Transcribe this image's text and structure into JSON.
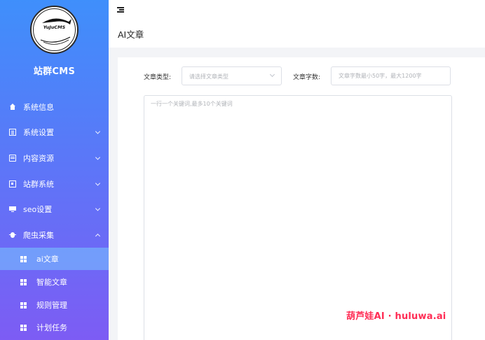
{
  "brand": {
    "logo_text": "YuJuCMS",
    "site_name": "站群CMS"
  },
  "sidebar": {
    "items": [
      {
        "label": "系统信息",
        "icon": "home-icon",
        "has_children": false
      },
      {
        "label": "系统设置",
        "icon": "list-icon",
        "has_children": true
      },
      {
        "label": "内容资源",
        "icon": "book-icon",
        "has_children": true
      },
      {
        "label": "站群系统",
        "icon": "box-icon",
        "has_children": true
      },
      {
        "label": "seo设置",
        "icon": "monitor-icon",
        "has_children": true
      },
      {
        "label": "爬虫采集",
        "icon": "bug-icon",
        "has_children": true,
        "expanded": true
      }
    ],
    "sub_items": [
      {
        "label": "ai文章",
        "active": true
      },
      {
        "label": "智能文章",
        "active": false
      },
      {
        "label": "规则管理",
        "active": false
      },
      {
        "label": "计划任务",
        "active": false
      }
    ]
  },
  "header": {
    "title": "AI文章"
  },
  "form": {
    "type_label": "文章类型:",
    "type_placeholder": "请选择文章类型",
    "count_label": "文章字数:",
    "count_placeholder": "文章字数最小50字，最大1200字",
    "keywords_placeholder": "一行一个关键词,最多10个关键词"
  },
  "watermark": "葫芦娃AI · huluwa.ai",
  "colors": {
    "sidebar_top": "#3f8ffb",
    "sidebar_bottom": "#7d5cf4",
    "active_sub": "#78c8ff",
    "watermark": "#ff2d55"
  }
}
